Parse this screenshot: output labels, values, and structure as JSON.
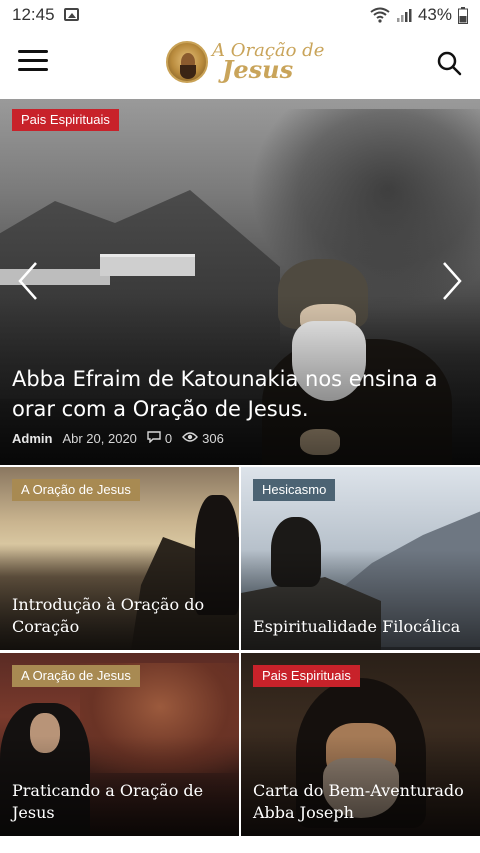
{
  "status_bar": {
    "time": "12:45",
    "battery": "43%",
    "icons": [
      "image-icon",
      "wifi-icon",
      "signal-icon",
      "battery-icon"
    ]
  },
  "app_bar": {
    "logo_line1": "A Oração de",
    "logo_line2": "Jesus",
    "menu_icon": "menu-icon",
    "search_icon": "search-icon"
  },
  "hero": {
    "category": "Pais Espirituais",
    "title": "Abba Efraim de Katounakia nos ensina a orar com a Oração de Jesus.",
    "author": "Admin",
    "date": "Abr 20, 2020",
    "comments": "0",
    "views": "306"
  },
  "cards": [
    {
      "category": "A Oração de Jesus",
      "title": "Introdução à Oração do Coração"
    },
    {
      "category": "Hesicasmo",
      "title": "Espiritualidade Filocálica"
    },
    {
      "category": "A Oração de Jesus",
      "title": "Praticando a Oração de Jesus"
    },
    {
      "category": "Pais Espirituais",
      "title": "Carta do Bem-Aventurado Abba Joseph"
    }
  ],
  "colors": {
    "badge_red": "#c8222a",
    "badge_gold": "#a88a52",
    "badge_slate": "#4c6373",
    "logo_gold": "#c9a45a"
  }
}
